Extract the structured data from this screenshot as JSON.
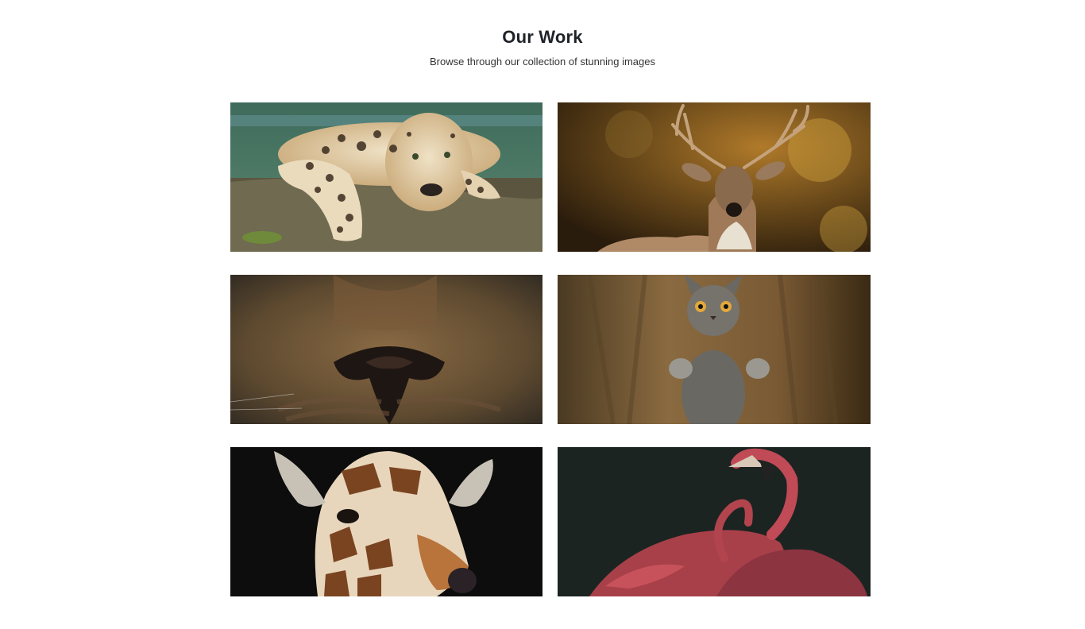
{
  "header": {
    "title": "Our Work",
    "subtitle": "Browse through our collection of stunning images"
  },
  "gallery": {
    "images": [
      {
        "subject": "leopard-on-log"
      },
      {
        "subject": "deer-with-antlers"
      },
      {
        "subject": "lion-nose-closeup"
      },
      {
        "subject": "gray-kitten-standing"
      },
      {
        "subject": "giraffe-head"
      },
      {
        "subject": "pink-flamingos"
      }
    ]
  }
}
